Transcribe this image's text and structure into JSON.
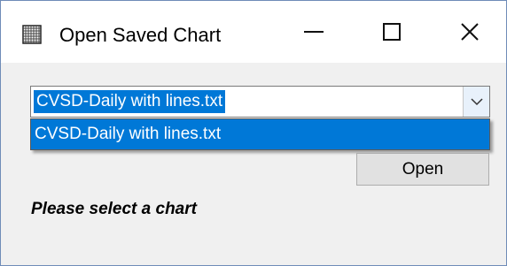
{
  "window": {
    "title": "Open Saved Chart",
    "controls": {
      "minimize_icon": "minimize-icon",
      "maximize_icon": "maximize-icon",
      "close_glyph": "✕"
    }
  },
  "combo": {
    "selected_value": "CVSD-Daily with lines.txt",
    "dropdown_icon": "chevron-down-icon",
    "options": [
      "CVSD-Daily with lines.txt"
    ]
  },
  "buttons": {
    "open_label": "Open"
  },
  "status": {
    "message": "Please select a chart"
  },
  "colors": {
    "accent": "#0078d7",
    "window_bg": "#f0f0f0",
    "titlebar_bg": "#ffffff",
    "border": "#6f8cb8"
  }
}
